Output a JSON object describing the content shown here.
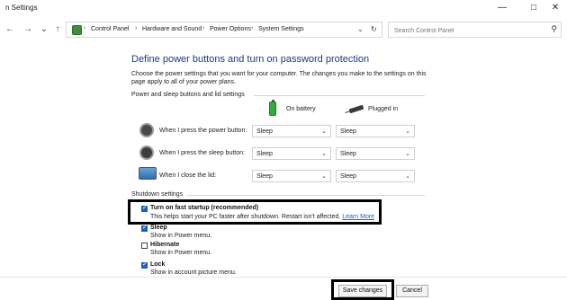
{
  "window": {
    "title": "n Settings",
    "minimize_glyph": "—",
    "maximize_glyph": "□",
    "close_glyph": "✕"
  },
  "nav": {
    "back_glyph": "←",
    "forward_glyph": "→",
    "recent_glyph": "⌄",
    "up_glyph": "↑",
    "breadcrumb": [
      "Control Panel",
      "Hardware and Sound",
      "Power Options",
      "System Settings"
    ],
    "address_dropdown_glyph": "⌄",
    "refresh_glyph": "↻"
  },
  "search": {
    "placeholder": "Search Control Panel",
    "icon": "search-icon"
  },
  "main": {
    "heading": "Define power buttons and turn on password protection",
    "description": "Choose the power settings that you want for your computer. The changes you make to the settings on this page apply to all of your power plans.",
    "power_section_title": "Power and sleep buttons and lid settings",
    "col_battery": "On battery",
    "col_plugged": "Plugged in",
    "rows": [
      {
        "label": "When I press the power button:",
        "battery": "Sleep",
        "plugged": "Sleep",
        "icon": "power-icon"
      },
      {
        "label": "When I press the sleep button:",
        "battery": "Sleep",
        "plugged": "Sleep",
        "icon": "sleep-moon-icon"
      },
      {
        "label": "When I close the lid:",
        "battery": "Sleep",
        "plugged": "Sleep",
        "icon": "laptop-lid-icon"
      }
    ],
    "shutdown_title": "Shutdown settings",
    "options": [
      {
        "label": "Turn on fast startup (recommended)",
        "sub": "This helps start your PC faster after shutdown. Restart isn't affected.",
        "link": "Learn More",
        "checked": true
      },
      {
        "label": "Sleep",
        "sub": "Show in Power menu.",
        "checked": true
      },
      {
        "label": "Hibernate",
        "sub": "Show in Power menu.",
        "checked": false
      },
      {
        "label": "Lock",
        "sub": "Show in account picture menu.",
        "checked": true
      }
    ]
  },
  "footer": {
    "save_label": "Save changes",
    "cancel_label": "Cancel"
  },
  "colors": {
    "heading": "#1e3a8a",
    "link": "#1f5fbf",
    "checkbox_checked": "#1f5fbf",
    "highlight_box": "#000000"
  }
}
